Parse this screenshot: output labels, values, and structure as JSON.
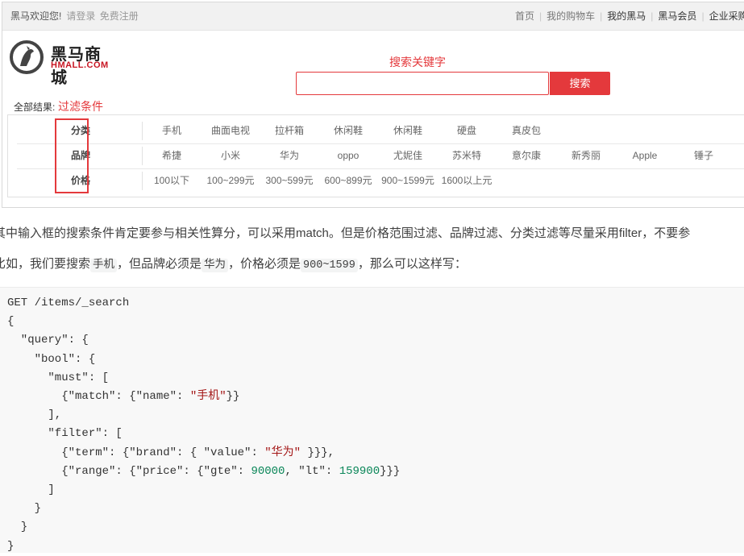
{
  "topbar": {
    "welcome": "黑马欢迎您!",
    "login": "请登录",
    "register": "免费注册",
    "nav": [
      "首页",
      "我的购物车",
      "我的黑马",
      "黑马会员",
      "企业采购"
    ]
  },
  "logo": {
    "cn": "黑马商城",
    "en": "HMALL.COM"
  },
  "annotations": {
    "keyword": "搜索关键字",
    "filter_conditions": "过滤条件"
  },
  "search": {
    "placeholder": "",
    "button": "搜索"
  },
  "results_label": "全部结果:",
  "filters": [
    {
      "key": "分类",
      "values": [
        "手机",
        "曲面电视",
        "拉杆箱",
        "休闲鞋",
        "休闲鞋",
        "硬盘",
        "真皮包"
      ]
    },
    {
      "key": "品牌",
      "values": [
        "希捷",
        "小米",
        "华为",
        "oppo",
        "尤妮佳",
        "苏米特",
        "意尔康",
        "新秀丽",
        "Apple",
        "锤子"
      ]
    },
    {
      "key": "价格",
      "values": [
        "100以下",
        "100~299元",
        "300~599元",
        "600~899元",
        "900~1599元",
        "1600以上元"
      ]
    }
  ],
  "article": {
    "p1": "其中输入框的搜索条件肯定要参与相关性算分，可以采用match。但是价格范围过滤、品牌过滤、分类过滤等尽量采用filter，不要参",
    "p2_a": "比如，我们要搜索",
    "p2_code1": "手机",
    "p2_b": "，但品牌必须是",
    "p2_code2": "华为",
    "p2_c": "，价格必须是",
    "p2_code3": "900~1599",
    "p2_d": "，那么可以这样写："
  },
  "code": {
    "line1": "GET /items/_search",
    "match_value": "\"手机\"",
    "brand_value": "\"华为\"",
    "gte": "90000",
    "lt": "159900"
  },
  "colors": {
    "accent_red": "#e4393c",
    "code_bg": "#f8f8f8"
  }
}
